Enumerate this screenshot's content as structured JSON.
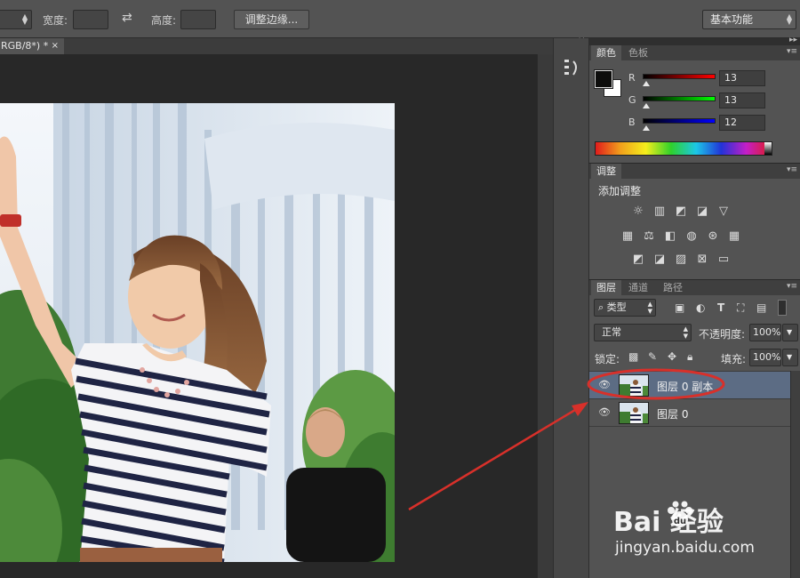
{
  "options_bar": {
    "width_label": "宽度:",
    "height_label": "高度:",
    "refine_edge_label": "调整边缘...",
    "workspace_value": "基本功能"
  },
  "document": {
    "tab_label": "RGB/8*) *",
    "close_glyph": "×"
  },
  "color_panel": {
    "tabs": [
      "颜色",
      "色板"
    ],
    "channels": [
      {
        "name": "R",
        "value": "13",
        "fraction": 0.05,
        "color_from": "#000000",
        "color_to": "#ff0000"
      },
      {
        "name": "G",
        "value": "13",
        "fraction": 0.05,
        "color_from": "#000000",
        "color_to": "#00ff00"
      },
      {
        "name": "B",
        "value": "12",
        "fraction": 0.05,
        "color_from": "#000000",
        "color_to": "#0000ff"
      }
    ],
    "foreground_color": "#0d0d0c",
    "background_color": "#ffffff"
  },
  "adjustments_panel": {
    "tab": "调整",
    "title": "添加调整",
    "rows": [
      [
        "brightness-contrast-icon",
        "levels-icon",
        "curves-icon",
        "exposure-icon",
        "vibrance-icon"
      ],
      [
        "hue-saturation-icon",
        "color-balance-icon",
        "black-white-icon",
        "photo-filter-icon",
        "channel-mixer-icon",
        "color-lookup-icon"
      ],
      [
        "invert-icon",
        "posterize-icon",
        "threshold-icon",
        "selective-color-icon",
        "gradient-map-icon"
      ]
    ]
  },
  "layers_panel": {
    "tabs": [
      "图层",
      "通道",
      "路径"
    ],
    "filter_type": "类型",
    "blend_mode": "正常",
    "opacity_label": "不透明度:",
    "opacity_value": "100%",
    "lock_label": "锁定:",
    "fill_label": "填充:",
    "fill_value": "100%",
    "layers": [
      {
        "name": "图层 0 副本",
        "selected": true
      },
      {
        "name": "图层 0",
        "selected": false
      }
    ]
  },
  "annotation": {
    "color": "#d8302a"
  },
  "watermark": {
    "logo_text": "Bai 经验",
    "url": "jingyan.baidu.com"
  }
}
